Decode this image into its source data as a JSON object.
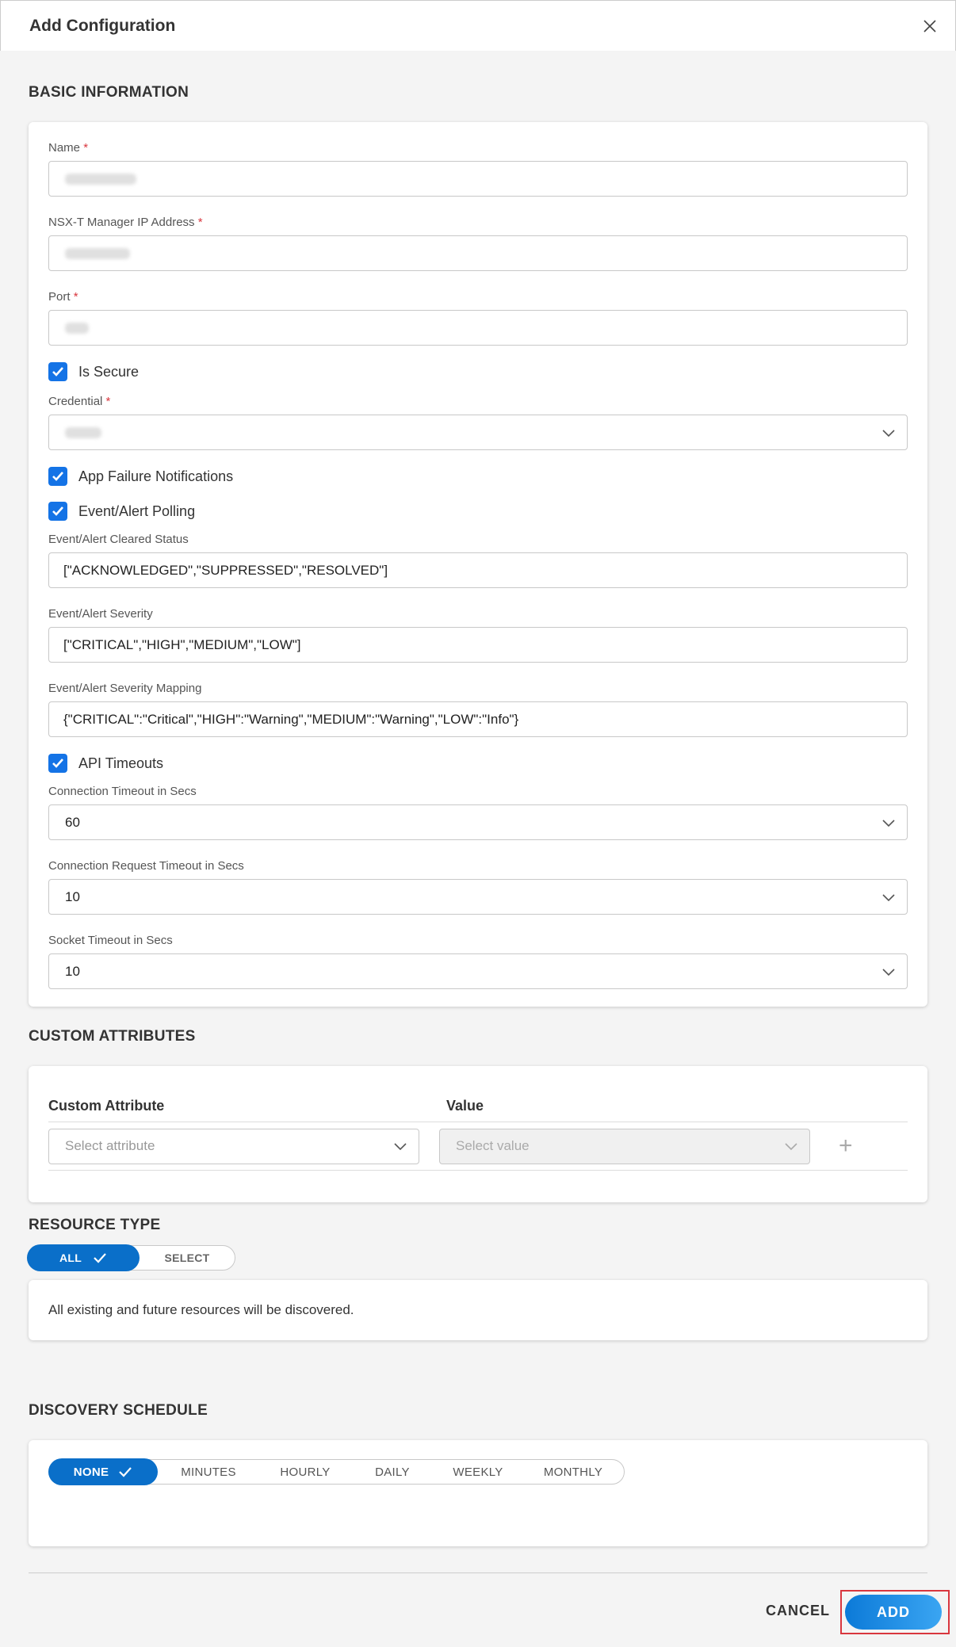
{
  "dialog": {
    "title": "Add Configuration"
  },
  "basic": {
    "section_title": "BASIC INFORMATION",
    "name_label": "Name",
    "ip_label": "NSX-T Manager IP Address",
    "port_label": "Port",
    "is_secure_label": "Is Secure",
    "credential_label": "Credential",
    "app_failure_label": "App Failure Notifications",
    "event_polling_label": "Event/Alert Polling",
    "cleared_status_label": "Event/Alert Cleared Status",
    "cleared_status_value": "[\"ACKNOWLEDGED\",\"SUPPRESSED\",\"RESOLVED\"]",
    "severity_label": "Event/Alert Severity",
    "severity_value": "[\"CRITICAL\",\"HIGH\",\"MEDIUM\",\"LOW\"]",
    "severity_mapping_label": "Event/Alert Severity Mapping",
    "severity_mapping_value": "{\"CRITICAL\":\"Critical\",\"HIGH\":\"Warning\",\"MEDIUM\":\"Warning\",\"LOW\":\"Info\"}",
    "api_timeouts_label": "API Timeouts",
    "conn_timeout_label": "Connection Timeout in Secs",
    "conn_timeout_value": "60",
    "conn_req_timeout_label": "Connection Request Timeout in Secs",
    "conn_req_timeout_value": "10",
    "socket_timeout_label": "Socket Timeout in Secs",
    "socket_timeout_value": "10",
    "required_mark": "*"
  },
  "custom": {
    "section_title": "CUSTOM ATTRIBUTES",
    "col_attribute": "Custom Attribute",
    "col_value": "Value",
    "attribute_placeholder": "Select attribute",
    "value_placeholder": "Select value",
    "add_icon_glyph": "+"
  },
  "resource": {
    "section_title": "RESOURCE TYPE",
    "opt_all": "ALL",
    "opt_select": "SELECT",
    "description": "All existing and future resources will be discovered."
  },
  "schedule": {
    "section_title": "DISCOVERY SCHEDULE",
    "options": [
      "NONE",
      "MINUTES",
      "HOURLY",
      "DAILY",
      "WEEKLY",
      "MONTHLY"
    ]
  },
  "footer": {
    "cancel_label": "CANCEL",
    "add_label": "ADD"
  },
  "colors": {
    "accent": "#1473e6",
    "toggle_active": "#0a6fc9",
    "required": "#d9363e"
  },
  "icons": {
    "close": "close-icon",
    "chevron": "chevron-down-icon",
    "check": "checkmark-icon",
    "plus": "plus-icon"
  }
}
